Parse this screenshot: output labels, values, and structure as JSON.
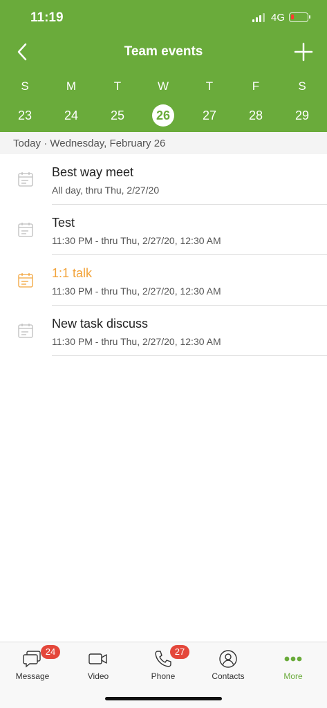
{
  "status_bar": {
    "time": "11:19",
    "network": "4G"
  },
  "header": {
    "title": "Team events",
    "accent_color": "#6aab3b",
    "back_icon": "chevron-left-icon",
    "add_icon": "plus-icon"
  },
  "week": {
    "days": [
      {
        "letter": "S",
        "number": "23"
      },
      {
        "letter": "M",
        "number": "24"
      },
      {
        "letter": "T",
        "number": "25"
      },
      {
        "letter": "W",
        "number": "26"
      },
      {
        "letter": "T",
        "number": "27"
      },
      {
        "letter": "F",
        "number": "28"
      },
      {
        "letter": "S",
        "number": "29"
      }
    ],
    "selected": "26"
  },
  "date_banner": "Today · Wednesday, February 26",
  "events": [
    {
      "title": "Best way meet",
      "subtitle": "All day, thru Thu, 2/27/20",
      "icon": "calendar-icon"
    },
    {
      "title": "Test",
      "subtitle": "11:30 PM - thru Thu, 2/27/20, 12:30 AM",
      "icon": "calendar-icon"
    },
    {
      "title": "1:1 talk",
      "subtitle": "11:30 PM - thru Thu, 2/27/20, 12:30 AM",
      "icon": "calendar-icon",
      "highlight_color": "#f2a33a"
    },
    {
      "title": "New task discuss",
      "subtitle": "11:30 PM - thru Thu, 2/27/20, 12:30 AM",
      "icon": "calendar-icon"
    }
  ],
  "tabbar": {
    "tabs": [
      {
        "label": "Message",
        "icon": "message-icon",
        "badge": "24"
      },
      {
        "label": "Video",
        "icon": "video-icon"
      },
      {
        "label": "Phone",
        "icon": "phone-icon",
        "badge": "27"
      },
      {
        "label": "Contacts",
        "icon": "contacts-icon"
      },
      {
        "label": "More",
        "icon": "more-icon",
        "active": true
      }
    ],
    "badge_color": "#e4473b"
  }
}
